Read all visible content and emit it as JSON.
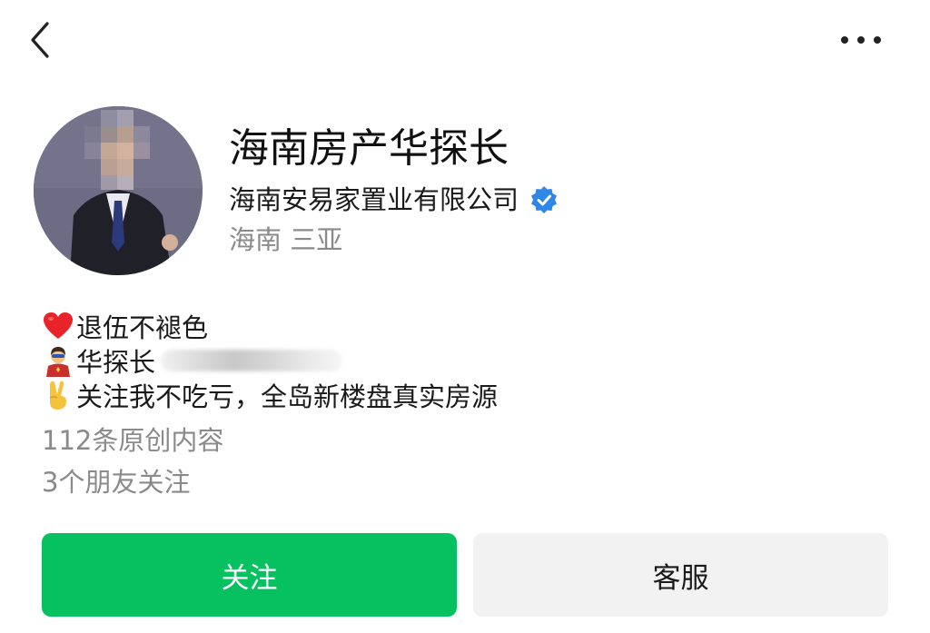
{
  "nav": {
    "back_icon": "chevron-left-icon",
    "more_icon": "more-dots-icon"
  },
  "profile": {
    "avatar_icon": "avatar-blurred-portrait",
    "name": "海南房产华探长",
    "company": "海南安易家置业有限公司",
    "verified_icon": "verified-badge-icon",
    "verified_color": "#2f86e7",
    "location": "海南 三亚"
  },
  "bio": {
    "line1": {
      "emoji": "red-heart-icon",
      "text": "退伍不褪色"
    },
    "line2": {
      "emoji": "superhero-icon",
      "text": "华探长"
    },
    "line3": {
      "emoji": "victory-hand-icon",
      "text": "关注我不吃亏，全岛新楼盘真实房源"
    }
  },
  "stats": {
    "original_count": "112条原创内容",
    "friends_following": "3个朋友关注"
  },
  "actions": {
    "follow_label": "关注",
    "service_label": "客服",
    "accent": "#07c160"
  }
}
